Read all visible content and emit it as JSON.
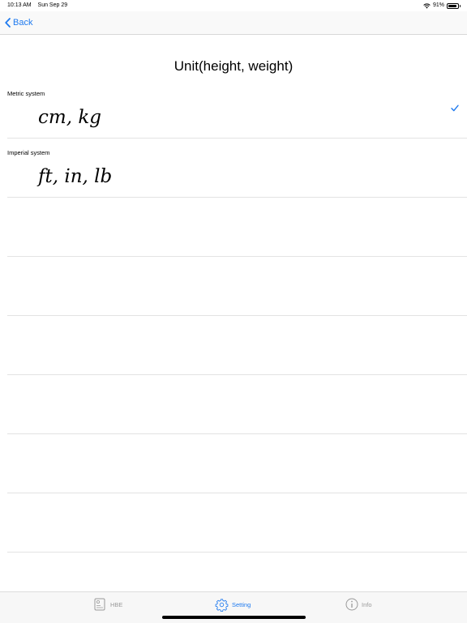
{
  "status_bar": {
    "time": "10:13 AM",
    "date": "Sun Sep 29",
    "battery": "91%"
  },
  "nav": {
    "back_label": "Back"
  },
  "page": {
    "title": "Unit(height, weight)"
  },
  "options": [
    {
      "label": "Metric system",
      "units": "cm, kg",
      "selected": true
    },
    {
      "label": "Imperial system",
      "units": "ft, in, lb",
      "selected": false
    }
  ],
  "tabs": [
    {
      "label": "HBE",
      "icon": "hbe-icon",
      "active": false
    },
    {
      "label": "Setting",
      "icon": "gear-icon",
      "active": true
    },
    {
      "label": "Info",
      "icon": "info-icon",
      "active": false
    }
  ],
  "colors": {
    "accent": "#1f7aef",
    "inactive_tab": "#9a9a9a",
    "separator": "#e3e3e3"
  }
}
